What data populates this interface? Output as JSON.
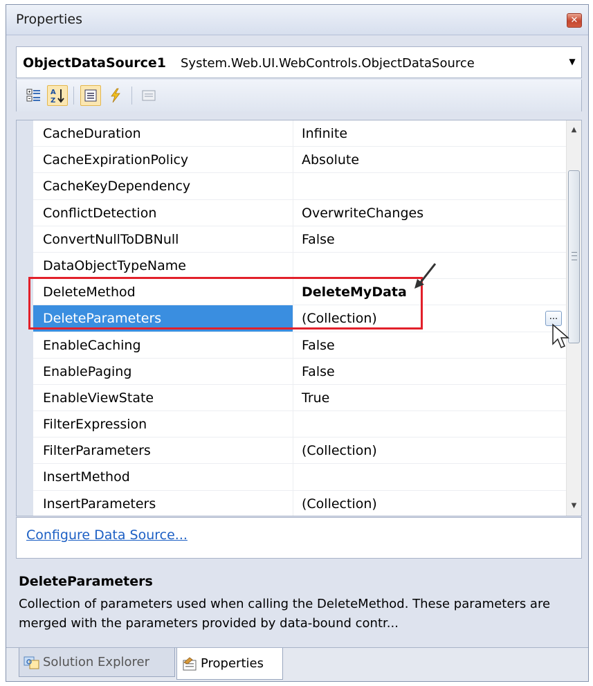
{
  "window": {
    "title": "Properties"
  },
  "object_selector": {
    "name": "ObjectDataSource1",
    "type": "System.Web.UI.WebControls.ObjectDataSource"
  },
  "toolbar": {
    "buttons": [
      "categorized",
      "alphabetical",
      "properties",
      "events",
      "property-pages"
    ],
    "pressed": [
      "alphabetical",
      "properties"
    ]
  },
  "properties": [
    {
      "name": "CacheDuration",
      "value": "Infinite"
    },
    {
      "name": "CacheExpirationPolicy",
      "value": "Absolute"
    },
    {
      "name": "CacheKeyDependency",
      "value": ""
    },
    {
      "name": "ConflictDetection",
      "value": "OverwriteChanges"
    },
    {
      "name": "ConvertNullToDBNull",
      "value": "False"
    },
    {
      "name": "DataObjectTypeName",
      "value": ""
    },
    {
      "name": "DeleteMethod",
      "value": "DeleteMyData"
    },
    {
      "name": "DeleteParameters",
      "value": "(Collection)"
    },
    {
      "name": "EnableCaching",
      "value": "False"
    },
    {
      "name": "EnablePaging",
      "value": "False"
    },
    {
      "name": "EnableViewState",
      "value": "True"
    },
    {
      "name": "FilterExpression",
      "value": ""
    },
    {
      "name": "FilterParameters",
      "value": "(Collection)"
    },
    {
      "name": "InsertMethod",
      "value": ""
    },
    {
      "name": "InsertParameters",
      "value": "(Collection)"
    }
  ],
  "selected_property": "DeleteParameters",
  "ellipsis_label": "...",
  "commands": {
    "configure_link": "Configure Data Source..."
  },
  "description": {
    "title": "DeleteParameters",
    "text": "Collection of parameters used when calling the DeleteMethod. These parameters are merged with the parameters provided by data-bound contr..."
  },
  "tabs": [
    {
      "label": "Solution Explorer",
      "active": false
    },
    {
      "label": "Properties",
      "active": true
    }
  ],
  "colors": {
    "selection": "#3a8ee0",
    "highlight_box": "#e2202a",
    "link": "#1c5fc4",
    "panel": "#dee3ee"
  }
}
